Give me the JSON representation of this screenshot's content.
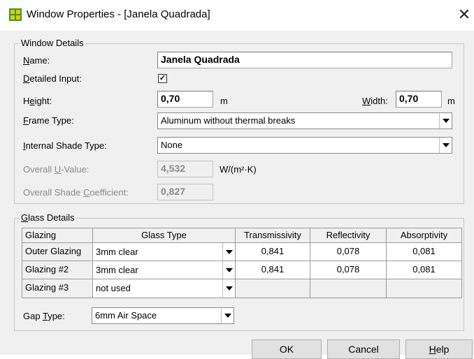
{
  "window": {
    "title": "Window Properties - [Janela Quadrada]",
    "close_glyph": "✕"
  },
  "window_details": {
    "group_label": "Window Details",
    "name": {
      "label": "Name:",
      "value": "Janela Quadrada"
    },
    "detailed_input": {
      "label": "Detailed Input:",
      "checked": true,
      "mark": "✓"
    },
    "height": {
      "label": "Height:",
      "value": "0,70",
      "unit": "m"
    },
    "width": {
      "label": "Width:",
      "value": "0,70",
      "unit": "m"
    },
    "frame_type": {
      "label": "Frame Type:",
      "value": "Aluminum without thermal breaks"
    },
    "internal_shade": {
      "label": "Internal Shade Type:",
      "value": "None"
    },
    "u_value": {
      "label": "Overall U-Value:",
      "value": "4,532",
      "unit": "W/(m²·K)"
    },
    "shade_coeff": {
      "label": "Overall Shade Coefficient:",
      "value": "0,827"
    }
  },
  "glass_details": {
    "group_label": "Glass Details",
    "headers": [
      "Glazing",
      "Glass Type",
      "Transmissivity",
      "Reflectivity",
      "Absorptivity"
    ],
    "rows": [
      {
        "glazing": "Outer Glazing",
        "glass_type": "3mm clear",
        "transmissivity": "0,841",
        "reflectivity": "0,078",
        "absorptivity": "0,081"
      },
      {
        "glazing": "Glazing #2",
        "glass_type": "3mm clear",
        "transmissivity": "0,841",
        "reflectivity": "0,078",
        "absorptivity": "0,081"
      },
      {
        "glazing": "Glazing #3",
        "glass_type": "not used",
        "transmissivity": "",
        "reflectivity": "",
        "absorptivity": ""
      }
    ],
    "gap_type": {
      "label": "Gap Type:",
      "value": "6mm Air Space"
    }
  },
  "buttons": {
    "ok": "OK",
    "cancel": "Cancel",
    "help": "Help"
  },
  "colors": {
    "icon_green": "#2e9b2e",
    "icon_yellow": "#f2c200",
    "dialog_bg": "#f0f0f0"
  }
}
